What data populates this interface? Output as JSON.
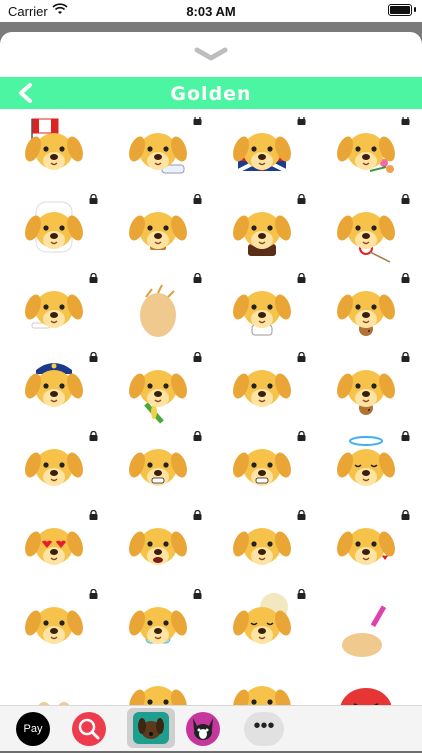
{
  "status_bar": {
    "carrier": "Carrier",
    "time": "8:03 AM"
  },
  "header": {
    "title": "Golden",
    "back_icon": "chevron-left-icon"
  },
  "grid": {
    "rows": 8,
    "cols": 4,
    "stickers": [
      {
        "name": "canada-flag",
        "locked": false
      },
      {
        "name": "baby-bottle",
        "locked": true
      },
      {
        "name": "uk-flag-sign",
        "locked": true
      },
      {
        "name": "bouquet",
        "locked": true
      },
      {
        "name": "tooth",
        "locked": true
      },
      {
        "name": "burger",
        "locked": true
      },
      {
        "name": "birthday-cake",
        "locked": true
      },
      {
        "name": "lollipop",
        "locked": true
      },
      {
        "name": "bone",
        "locked": true
      },
      {
        "name": "clapping-hands",
        "locked": true
      },
      {
        "name": "coffee-cup",
        "locked": true
      },
      {
        "name": "cookie",
        "locked": true
      },
      {
        "name": "police-hat",
        "locked": true
      },
      {
        "name": "corn",
        "locked": true
      },
      {
        "name": "tear",
        "locked": true
      },
      {
        "name": "donut",
        "locked": true
      },
      {
        "name": "blushing",
        "locked": true
      },
      {
        "name": "grimace",
        "locked": true
      },
      {
        "name": "grin",
        "locked": true
      },
      {
        "name": "angel-halo",
        "locked": true
      },
      {
        "name": "heart-eyes",
        "locked": true
      },
      {
        "name": "open-mouth",
        "locked": true
      },
      {
        "name": "smile",
        "locked": true
      },
      {
        "name": "kiss",
        "locked": true
      },
      {
        "name": "neutral",
        "locked": true
      },
      {
        "name": "face-mask",
        "locked": true
      },
      {
        "name": "moon-sleep",
        "locked": true
      },
      {
        "name": "nail-polish",
        "locked": false
      },
      {
        "name": "paws",
        "locked": false
      },
      {
        "name": "peek",
        "locked": false
      },
      {
        "name": "peek-2",
        "locked": false
      },
      {
        "name": "angry",
        "locked": false
      }
    ]
  },
  "colors": {
    "accent": "#4cf5a2",
    "dog": "#f7c24a",
    "ear": "#e9a536"
  },
  "bottom_bar": {
    "apple_pay_label": "Pay",
    "apps": [
      "apple-pay-icon",
      "search-images-icon",
      "golden-dog-app-icon",
      "boston-terrier-app-icon",
      "more-apps-icon"
    ],
    "more_label": "•••"
  }
}
